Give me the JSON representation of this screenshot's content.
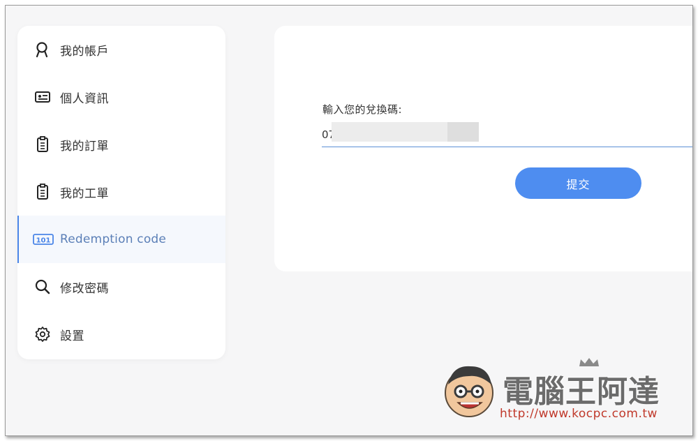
{
  "sidebar": {
    "items": [
      {
        "label": "我的帳戶",
        "icon": "user-icon",
        "active": false
      },
      {
        "label": "個人資訊",
        "icon": "id-card-icon",
        "active": false
      },
      {
        "label": "我的訂單",
        "icon": "clipboard-list-icon",
        "active": false
      },
      {
        "label": "我的工單",
        "icon": "clipboard-list-icon",
        "active": false
      },
      {
        "label": "Redemption code",
        "icon": "code-101-icon",
        "active": true
      },
      {
        "label": "修改密碼",
        "icon": "search-icon",
        "active": false
      },
      {
        "label": "設置",
        "icon": "gear-icon",
        "active": false
      }
    ]
  },
  "redeem": {
    "label": "輸入您的兌換碼:",
    "code_value": "07",
    "submit_label": "提交"
  },
  "watermark": {
    "title": "電腦王阿達",
    "url": "http://www.kocpc.com.tw"
  },
  "colors": {
    "accent": "#4e8df0",
    "active_text": "#5b7fb7",
    "active_bg": "#f5f8fd",
    "page_bg": "#f6f6f7"
  }
}
